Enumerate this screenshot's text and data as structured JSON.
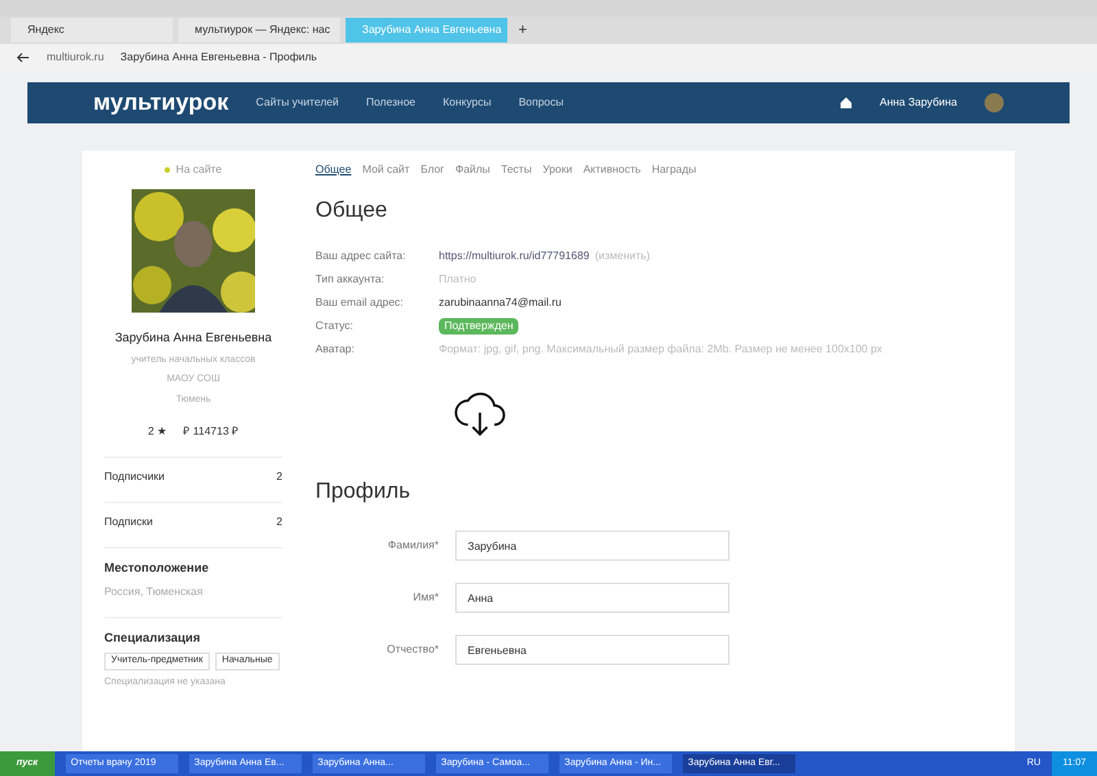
{
  "browser": {
    "tabs": [
      {
        "label": "Яндекс",
        "selected": false
      },
      {
        "label": "мультиурок — Яндекс: нас",
        "selected": false
      },
      {
        "label": "Зарубина Анна Евгеньевна",
        "selected": true
      }
    ],
    "new_tab": "+",
    "url_domain": "multiurok.ru",
    "url_title": "Зарубина Анна Евгеньевна - Профиль"
  },
  "site_header": {
    "logo": "мультиурок",
    "nav": [
      "Сайты учителей",
      "Полезное",
      "Конкурсы",
      "Вопросы"
    ],
    "user": "Анна Зарубина"
  },
  "sidebar": {
    "online": "На сайте",
    "name": "Зарубина Анна Евгеньевна",
    "subtitle": [
      "учитель начальных классов",
      "МАОУ СОШ",
      "Тюмень"
    ],
    "rating_a": "2 ★",
    "rating_b": "₽ 114713 ₽",
    "stats": [
      {
        "label": "Подписчики",
        "count": "2"
      },
      {
        "label": "Подписки",
        "count": "2"
      }
    ],
    "location_title": "Местоположение",
    "location": "Россия, Тюменская",
    "specialization_title": "Специализация",
    "tags": [
      "Учитель-предметник",
      "Начальные"
    ],
    "more": "Специализация не указана"
  },
  "profile_tabs": [
    {
      "label": "Общее",
      "selected": true
    },
    {
      "label": "Мой сайт",
      "selected": false
    },
    {
      "label": "Блог",
      "selected": false
    },
    {
      "label": "Файлы",
      "selected": false
    },
    {
      "label": "Тесты",
      "selected": false
    },
    {
      "label": "Уроки",
      "selected": false
    },
    {
      "label": "Активность",
      "selected": false
    },
    {
      "label": "Награды",
      "selected": false
    }
  ],
  "general": {
    "title": "Общее",
    "rows": [
      {
        "kind": "link",
        "label": "Ваш адрес сайта:",
        "value": "https://multiurok.ru/id77791689",
        "extra": "(изменить)"
      },
      {
        "kind": "muted",
        "label": "Тип аккаунта:",
        "value": "Платно"
      },
      {
        "kind": "text",
        "label": "Ваш email адрес:",
        "value": "zarubinaanna74@mail.ru"
      },
      {
        "kind": "badge",
        "label": "Статус:",
        "value": "Подтвержден"
      },
      {
        "kind": "muted",
        "label": "Аватар:",
        "value": "Формат: jpg, gif, png. Максимальный размер файла: 2Mb. Размер не менее 100x100 px"
      }
    ]
  },
  "profile": {
    "title": "Профиль",
    "fields": [
      {
        "label": "Фамилия*",
        "value": "Зарубина"
      },
      {
        "label": "Имя*",
        "value": "Анна"
      },
      {
        "label": "Отчество*",
        "value": "Евгеньевна"
      }
    ]
  },
  "taskbar": {
    "start": "пуск",
    "items": [
      {
        "label": "Отчеты врачу 2019",
        "selected": false
      },
      {
        "label": "Зарубина Анна Ев...",
        "selected": false
      },
      {
        "label": "Зарубина Анна...",
        "selected": false
      },
      {
        "label": "Зарубина - Самоа...",
        "selected": false
      },
      {
        "label": "Зарубина Анна - Ин...",
        "selected": false
      },
      {
        "label": "Зарубина Анна Евг...",
        "selected": true
      }
    ],
    "lang": "RU",
    "clock": "11:07"
  }
}
